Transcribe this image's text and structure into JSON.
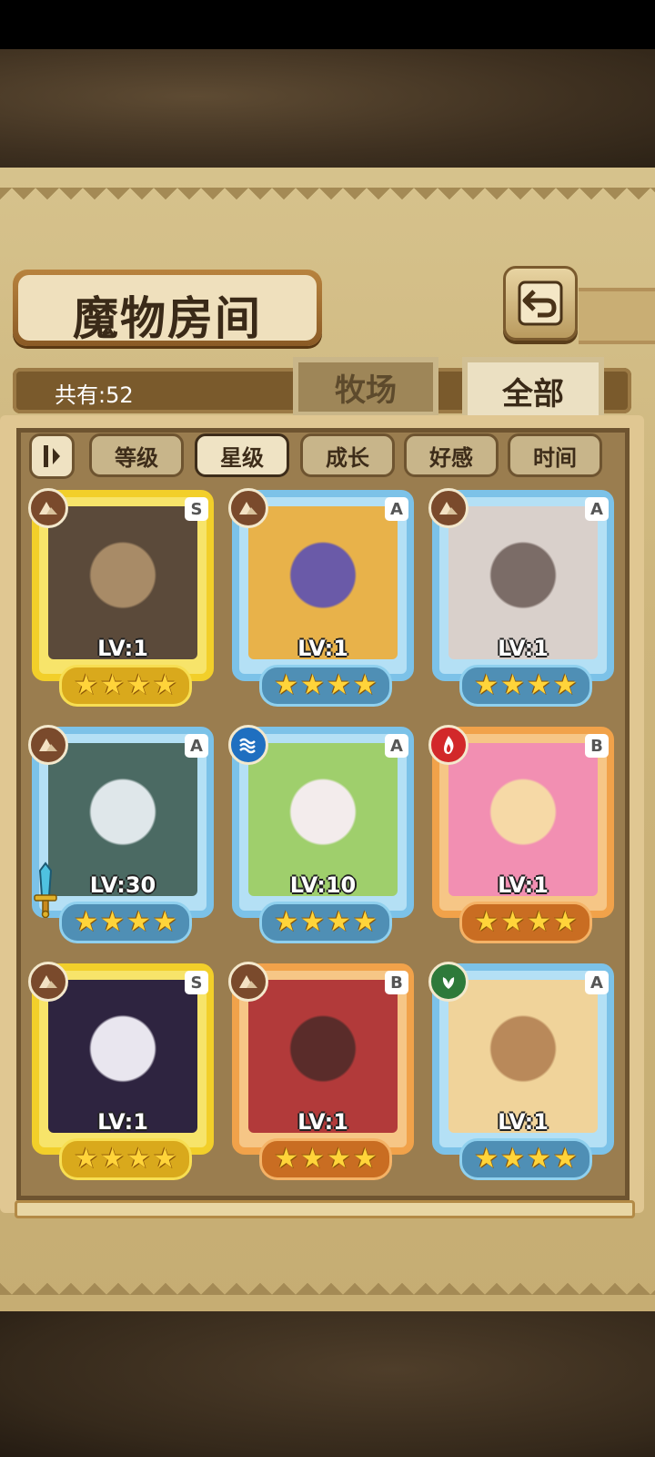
{
  "screen": {
    "title": "魔物房间",
    "count_text": "共有:52",
    "tabs": [
      {
        "label": "牧场",
        "active": false
      },
      {
        "label": "全部",
        "active": true
      }
    ],
    "sort_buttons": [
      {
        "label": "等级",
        "active": false
      },
      {
        "label": "星级",
        "active": true
      },
      {
        "label": "成长",
        "active": false
      },
      {
        "label": "好感",
        "active": false
      },
      {
        "label": "时间",
        "active": false
      }
    ]
  },
  "monsters": [
    {
      "level": "LV:1",
      "rank": "S",
      "frame": "gold",
      "element": "earth",
      "stars": 4
    },
    {
      "level": "LV:1",
      "rank": "A",
      "frame": "blue",
      "element": "earth",
      "stars": 4
    },
    {
      "level": "LV:1",
      "rank": "A",
      "frame": "blue",
      "element": "earth",
      "stars": 4
    },
    {
      "level": "LV:30",
      "rank": "A",
      "frame": "blue",
      "element": "earth",
      "stars": 4
    },
    {
      "level": "LV:10",
      "rank": "A",
      "frame": "blue",
      "element": "water",
      "stars": 4
    },
    {
      "level": "LV:1",
      "rank": "B",
      "frame": "orange",
      "element": "fire",
      "stars": 4
    },
    {
      "level": "LV:1",
      "rank": "S",
      "frame": "gold",
      "element": "earth",
      "stars": 4
    },
    {
      "level": "LV:1",
      "rank": "B",
      "frame": "orange",
      "element": "earth",
      "stars": 4
    },
    {
      "level": "LV:1",
      "rank": "A",
      "frame": "blue",
      "element": "wood",
      "stars": 4
    }
  ],
  "colors": {
    "earth": "#7a4a2c",
    "water": "#1f6fc0",
    "fire": "#d2282a",
    "wood": "#2e7a3a"
  }
}
